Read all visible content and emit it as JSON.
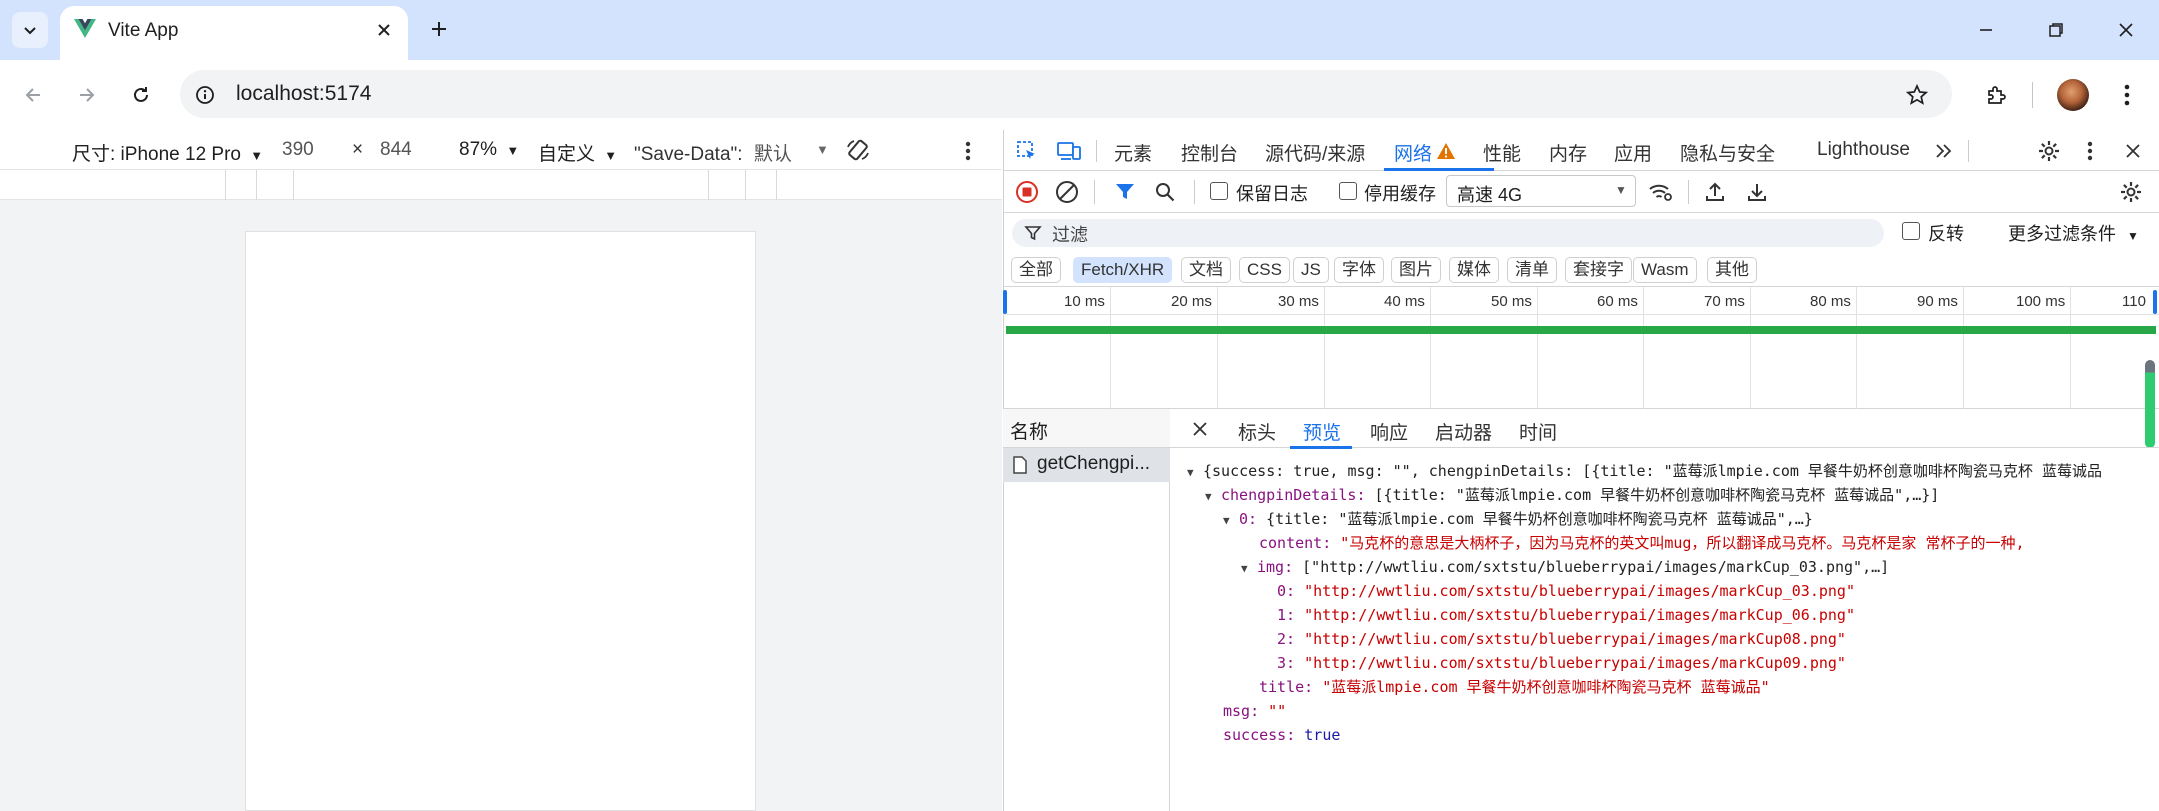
{
  "browser": {
    "tab_title": "Vite App",
    "url": "localhost:5174"
  },
  "device_toolbar": {
    "size_label": "尺寸: iPhone 12 Pro",
    "width": "390",
    "times": "×",
    "height": "844",
    "zoom": "87%",
    "custom": "自定义",
    "save_data_label": "\"Save-Data\":",
    "save_data_value": "默认"
  },
  "devtools": {
    "tabs": [
      "元素",
      "控制台",
      "源代码/来源",
      "网络",
      "性能",
      "内存",
      "应用",
      "隐私与安全",
      "Lighthouse"
    ],
    "active_tab": "网络",
    "preserve_log": "保留日志",
    "disable_cache": "停用缓存",
    "throttle": "高速 4G",
    "filter_placeholder": "过滤",
    "invert": "反转",
    "more_filters": "更多过滤条件",
    "chips": [
      "全部",
      "Fetch/XHR",
      "文档",
      "CSS",
      "JS",
      "字体",
      "图片",
      "媒体",
      "清单",
      "套接字",
      "Wasm",
      "其他"
    ],
    "active_chip": "Fetch/XHR",
    "timeline_ticks": [
      "10 ms",
      "20 ms",
      "30 ms",
      "40 ms",
      "50 ms",
      "60 ms",
      "70 ms",
      "80 ms",
      "90 ms",
      "100 ms",
      "110"
    ],
    "name_header": "名称",
    "request_name": "getChengpi...",
    "detail_tabs": [
      "标头",
      "预览",
      "响应",
      "启动器",
      "时间"
    ],
    "active_detail_tab": "预览",
    "colors": {
      "accent": "#1a73e8",
      "stop_red": "#d93025",
      "bar_green": "#27a745",
      "string_red": "#c80000",
      "key_purple": "#881280"
    }
  },
  "preview": {
    "root_summary": "{success: true, msg: \"\", chengpinDetails: [{title: \"蓝莓派lmpie.com 早餐牛奶杯创意咖啡杯陶瓷马克杯 蓝莓诚品",
    "chengpin_key": "chengpinDetails:",
    "chengpin_summary": "[{title: \"蓝莓派lmpie.com 早餐牛奶杯创意咖啡杯陶瓷马克杯 蓝莓诚品\",…}]",
    "item0_key": "0:",
    "item0_summary": "{title: \"蓝莓派lmpie.com 早餐牛奶杯创意咖啡杯陶瓷马克杯 蓝莓诚品\",…}",
    "content_key": "content:",
    "content_value": "\"马克杯的意思是大柄杯子，因为马克杯的英文叫mug，所以翻译成马克杯。马克杯是家 常杯子的一种,",
    "img_key": "img:",
    "img_summary": "[\"http://wwtliu.com/sxtstu/blueberrypai/images/markCup_03.png\",…]",
    "images": [
      {
        "key": "0:",
        "value": "\"http://wwtliu.com/sxtstu/blueberrypai/images/markCup_03.png\""
      },
      {
        "key": "1:",
        "value": "\"http://wwtliu.com/sxtstu/blueberrypai/images/markCup_06.png\""
      },
      {
        "key": "2:",
        "value": "\"http://wwtliu.com/sxtstu/blueberrypai/images/markCup08.png\""
      },
      {
        "key": "3:",
        "value": "\"http://wwtliu.com/sxtstu/blueberrypai/images/markCup09.png\""
      }
    ],
    "title_key": "title:",
    "title_value": "\"蓝莓派lmpie.com 早餐牛奶杯创意咖啡杯陶瓷马克杯 蓝莓诚品\"",
    "msg_key": "msg:",
    "msg_value": "\"\"",
    "success_key": "success:",
    "success_value": "true"
  }
}
